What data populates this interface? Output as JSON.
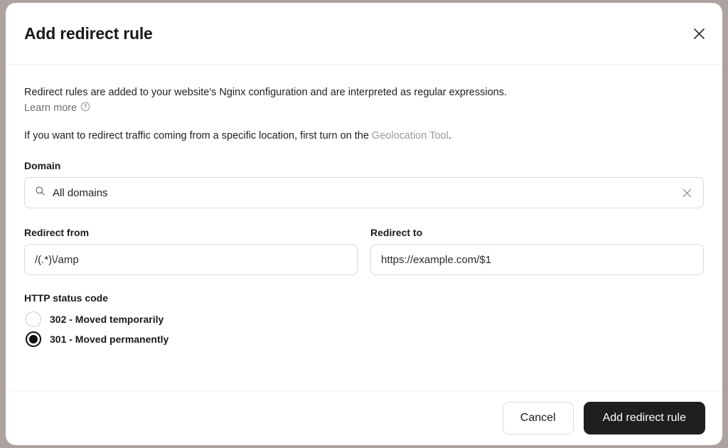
{
  "backdrop_color": "#ada3a0",
  "header": {
    "title": "Add redirect rule",
    "close_icon": "close-icon"
  },
  "body": {
    "intro_text": "Redirect rules are added to your website's Nginx configuration and are interpreted as regular expressions.",
    "learn_more_label": "Learn more",
    "learn_more_icon": "help-circle-icon",
    "geo_prefix": "If you want to redirect traffic coming from a specific location, first turn on the ",
    "geo_link_label": "Geolocation Tool",
    "geo_suffix": ".",
    "domain": {
      "label": "Domain",
      "search_icon": "search-icon",
      "value": "All domains",
      "placeholder": "All domains",
      "clear_icon": "close-icon"
    },
    "redirect_from": {
      "label": "Redirect from",
      "value": "/(.*)\\/amp",
      "placeholder": "/(.*)\\/amp"
    },
    "redirect_to": {
      "label": "Redirect to",
      "value": "https://example.com/$1",
      "placeholder": "https://example.com/$1"
    },
    "status_code": {
      "label": "HTTP status code",
      "options": [
        {
          "label": "302 - Moved temporarily",
          "value": "302",
          "selected": false
        },
        {
          "label": "301 - Moved permanently",
          "value": "301",
          "selected": true
        }
      ],
      "selected_value": "301"
    }
  },
  "footer": {
    "cancel_label": "Cancel",
    "submit_label": "Add redirect rule",
    "submit_color": "#1f1f1f"
  }
}
